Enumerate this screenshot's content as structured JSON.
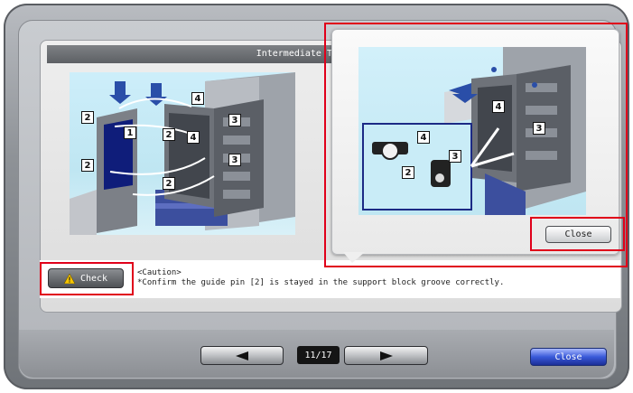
{
  "panel": {
    "title": "Intermediate T"
  },
  "instruction": {
    "check_label": "Check",
    "caution_heading": "<Caution>",
    "caution_text": "*Confirm the guide pin [2] is stayed in the support block groove correctly."
  },
  "illustration": {
    "main_callouts": [
      "2",
      "1",
      "2",
      "2",
      "4",
      "4",
      "2",
      "3",
      "3"
    ],
    "popup_callouts": [
      "4",
      "3",
      "4",
      "3",
      "2"
    ]
  },
  "popup": {
    "close_label": "Close"
  },
  "footer": {
    "prev_icon": "left-triangle-icon",
    "next_icon": "right-triangle-icon",
    "page_indicator": "11/17",
    "close_label": "Close"
  },
  "colors": {
    "highlight": "#e0001a",
    "close_button": "#2c47c4",
    "title_bar": "#6b6e72",
    "illustration_bg": "#c9ecf7"
  }
}
